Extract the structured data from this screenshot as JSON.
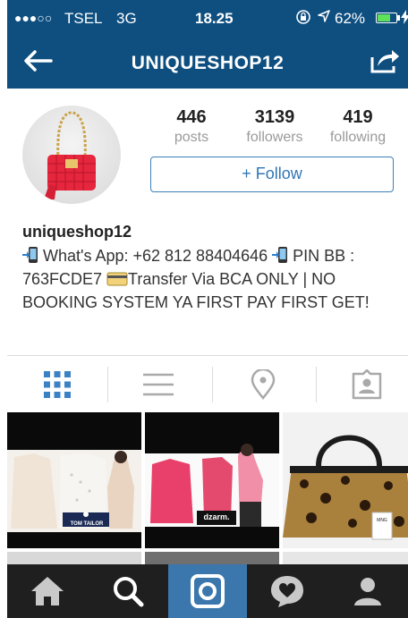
{
  "status_bar": {
    "signal": "●●●○○",
    "carrier": "TSEL",
    "network": "3G",
    "time": "18.25",
    "battery_text": "62%",
    "battery_level": 0.62,
    "colors": {
      "battery_fill": "#5fe25a"
    }
  },
  "nav": {
    "title": "UNIQUESHOP12",
    "back_icon": "arrow-left-icon",
    "share_icon": "share-icon"
  },
  "profile": {
    "stats": [
      {
        "value": "446",
        "label": "posts"
      },
      {
        "value": "3139",
        "label": "followers"
      },
      {
        "value": "419",
        "label": "following"
      }
    ],
    "follow_label": "+ Follow",
    "username": "uniqueshop12",
    "bio": {
      "part1": " What's App: +62 812 88404646 ",
      "part2": " PIN BB : 763FCDE7 ",
      "part3": "Transfer Via BCA ONLY | NO BOOKING SYSTEM YA FIRST PAY FIRST GET!"
    }
  },
  "tabs": [
    {
      "name": "grid-view",
      "icon": "grid-icon",
      "active": true
    },
    {
      "name": "list-view",
      "icon": "list-icon",
      "active": false
    },
    {
      "name": "location",
      "icon": "location-pin-icon",
      "active": false
    },
    {
      "name": "tagged",
      "icon": "tagged-person-icon",
      "active": false
    }
  ],
  "posts": [
    {
      "brand_label": "TOM TAILOR"
    },
    {
      "brand_label": "dzarm."
    },
    {
      "brand_label": "MNG"
    }
  ],
  "bottom_nav": [
    {
      "name": "home",
      "icon": "home-icon",
      "active": false
    },
    {
      "name": "explore",
      "icon": "search-icon",
      "active": false
    },
    {
      "name": "camera",
      "icon": "camera-icon",
      "active": true
    },
    {
      "name": "activity",
      "icon": "heart-bubble-icon",
      "active": false
    },
    {
      "name": "profile",
      "icon": "person-icon",
      "active": false
    }
  ],
  "colors": {
    "header_bg": "#0e4f80",
    "follow_accent": "#2e76b5",
    "bottom_bar_bg": "#1f1f1f",
    "bottom_active_bg": "#3b77ad",
    "tab_active": "#3b82c4",
    "tab_inactive": "#a9a9a9"
  }
}
